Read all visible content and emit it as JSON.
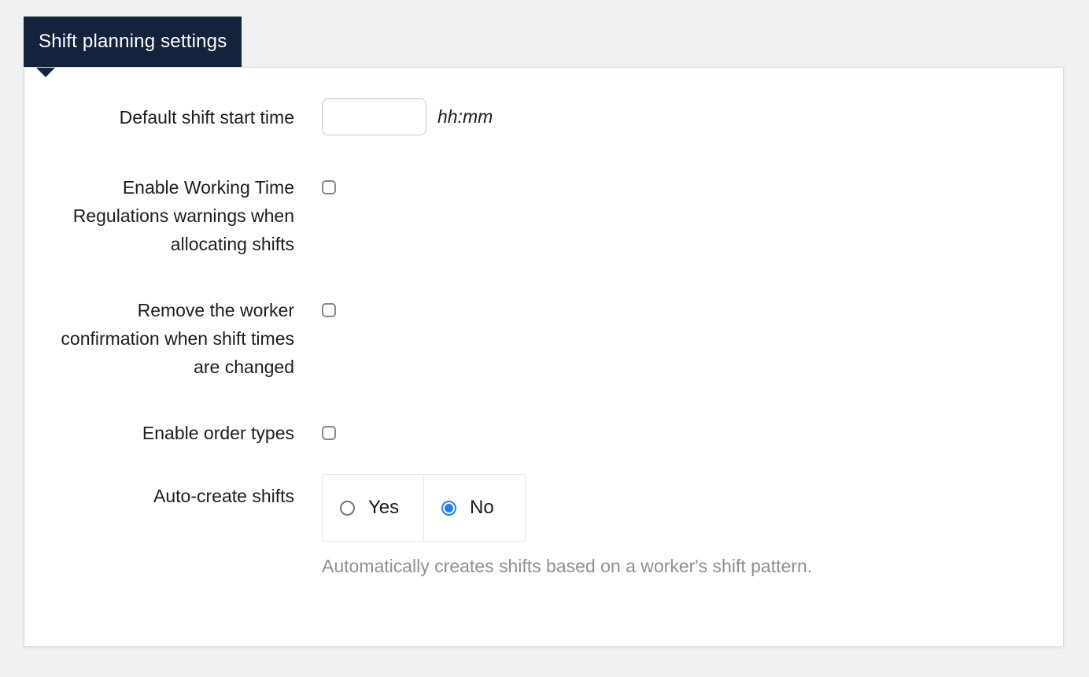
{
  "panel": {
    "title": "Shift planning settings"
  },
  "colors": {
    "page_bg": "#f0f1f3",
    "header_bg": "#13233d",
    "header_text": "#ffffff",
    "card_bg": "#ffffff",
    "card_border": "#d7d9dc",
    "label_text": "#1d1d1f",
    "help_text": "#8f9093",
    "input_border": "#c7c8ca",
    "checkbox_border": "#87878a",
    "group_border": "#e3e4e6",
    "radio_selected": "#2b7bf0"
  },
  "fields": [
    {
      "type": "text-input",
      "label": "Default shift start time",
      "value": "",
      "suffix": "hh:mm"
    },
    {
      "type": "checkbox",
      "label": "Enable Working Time Regulations warnings when allocating shifts",
      "checked": false
    },
    {
      "type": "checkbox",
      "label": "Remove the worker confirmation when shift times are changed",
      "checked": false
    },
    {
      "type": "checkbox",
      "label": "Enable order types",
      "checked": false
    },
    {
      "type": "radio-group",
      "label": "Auto-create shifts",
      "options": [
        "Yes",
        "No"
      ],
      "selected": "No",
      "help": "Automatically creates shifts based on a worker's shift pattern."
    }
  ]
}
